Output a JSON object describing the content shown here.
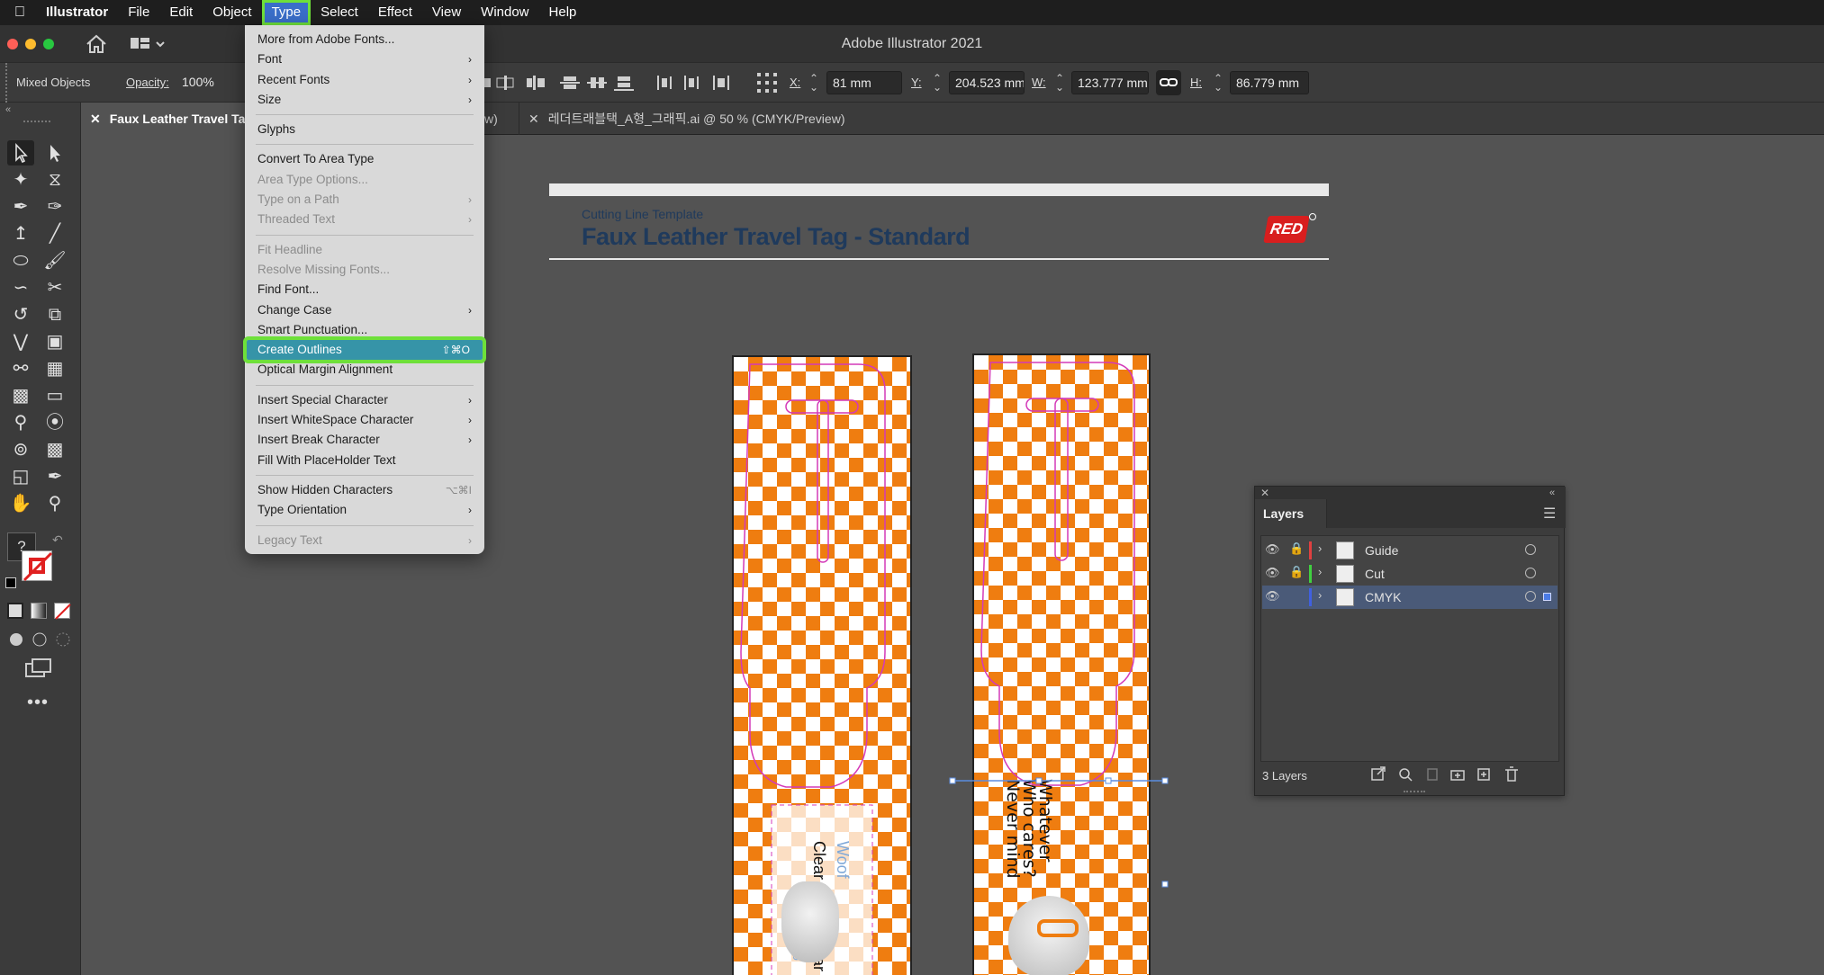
{
  "menubar": {
    "app_name": "Illustrator",
    "items": [
      "File",
      "Edit",
      "Object",
      "Type",
      "Select",
      "Effect",
      "View",
      "Window",
      "Help"
    ],
    "highlighted": "Type"
  },
  "window": {
    "title": "Adobe Illustrator 2021"
  },
  "control_bar": {
    "selection_label": "Mixed Objects",
    "opacity_label": "Opacity:",
    "opacity_value": "100%",
    "x_label": "X:",
    "x_value": "81 mm",
    "y_label": "Y:",
    "y_value": "204.523 mm",
    "w_label": "W:",
    "w_value": "123.777 mm",
    "h_label": "H:",
    "h_value": "86.779 mm"
  },
  "tabs": [
    {
      "label": "Faux Leather Travel Tag",
      "active": true
    },
    {
      "label": "w)",
      "active": false
    },
    {
      "label": "레더트래블택_A형_그래픽.ai @ 50 % (CMYK/Preview)",
      "active": false
    }
  ],
  "artboard": {
    "subtitle": "Cutting Line Template",
    "title": "Faux Leather Travel Tag - Standard",
    "logo": "RED",
    "tag_left_text_1": "Woof",
    "tag_left_text_2": "Clear Window Par",
    "tag_left_text_3": "wo",
    "tag_right_text": "Whatever Who cares? Never mind"
  },
  "type_menu": {
    "items": [
      {
        "label": "More from Adobe Fonts...",
        "disabled": false
      },
      {
        "label": "Font",
        "submenu": true
      },
      {
        "label": "Recent Fonts",
        "submenu": true
      },
      {
        "label": "Size",
        "submenu": true
      },
      {
        "sep": true
      },
      {
        "label": "Glyphs"
      },
      {
        "sep": true
      },
      {
        "label": "Convert To Area Type"
      },
      {
        "label": "Area Type Options...",
        "disabled": true
      },
      {
        "label": "Type on a Path",
        "disabled": true,
        "submenu": true
      },
      {
        "label": "Threaded Text",
        "disabled": true,
        "submenu": true
      },
      {
        "sep": true
      },
      {
        "label": "Fit Headline",
        "disabled": true
      },
      {
        "label": "Resolve Missing Fonts...",
        "disabled": true
      },
      {
        "label": "Find Font..."
      },
      {
        "label": "Change Case",
        "submenu": true
      },
      {
        "label": "Smart Punctuation..."
      },
      {
        "label": "Create Outlines",
        "shortcut": "⇧⌘O",
        "active": true
      },
      {
        "label": "Optical Margin Alignment"
      },
      {
        "sep": true
      },
      {
        "label": "Insert Special Character",
        "submenu": true
      },
      {
        "label": "Insert WhiteSpace Character",
        "submenu": true
      },
      {
        "label": "Insert Break Character",
        "submenu": true
      },
      {
        "label": "Fill With PlaceHolder Text"
      },
      {
        "sep": true
      },
      {
        "label": "Show Hidden Characters",
        "shortcut": "⌥⌘I"
      },
      {
        "label": "Type Orientation",
        "submenu": true
      },
      {
        "sep": true
      },
      {
        "label": "Legacy Text",
        "disabled": true,
        "submenu": true
      }
    ]
  },
  "layers_panel": {
    "title": "Layers",
    "layers": [
      {
        "name": "Guide",
        "color": "#e04040",
        "locked": true,
        "selected": false
      },
      {
        "name": "Cut",
        "color": "#40d040",
        "locked": true,
        "selected": false
      },
      {
        "name": "CMYK",
        "color": "#4060e0",
        "locked": false,
        "selected": true
      }
    ],
    "footer": "3 Layers"
  },
  "colors": {
    "checker": "#ef7d10",
    "cutline": "#d43ab8",
    "menu_highlight": "#3694a8",
    "focus_outline": "#6ee03a"
  }
}
